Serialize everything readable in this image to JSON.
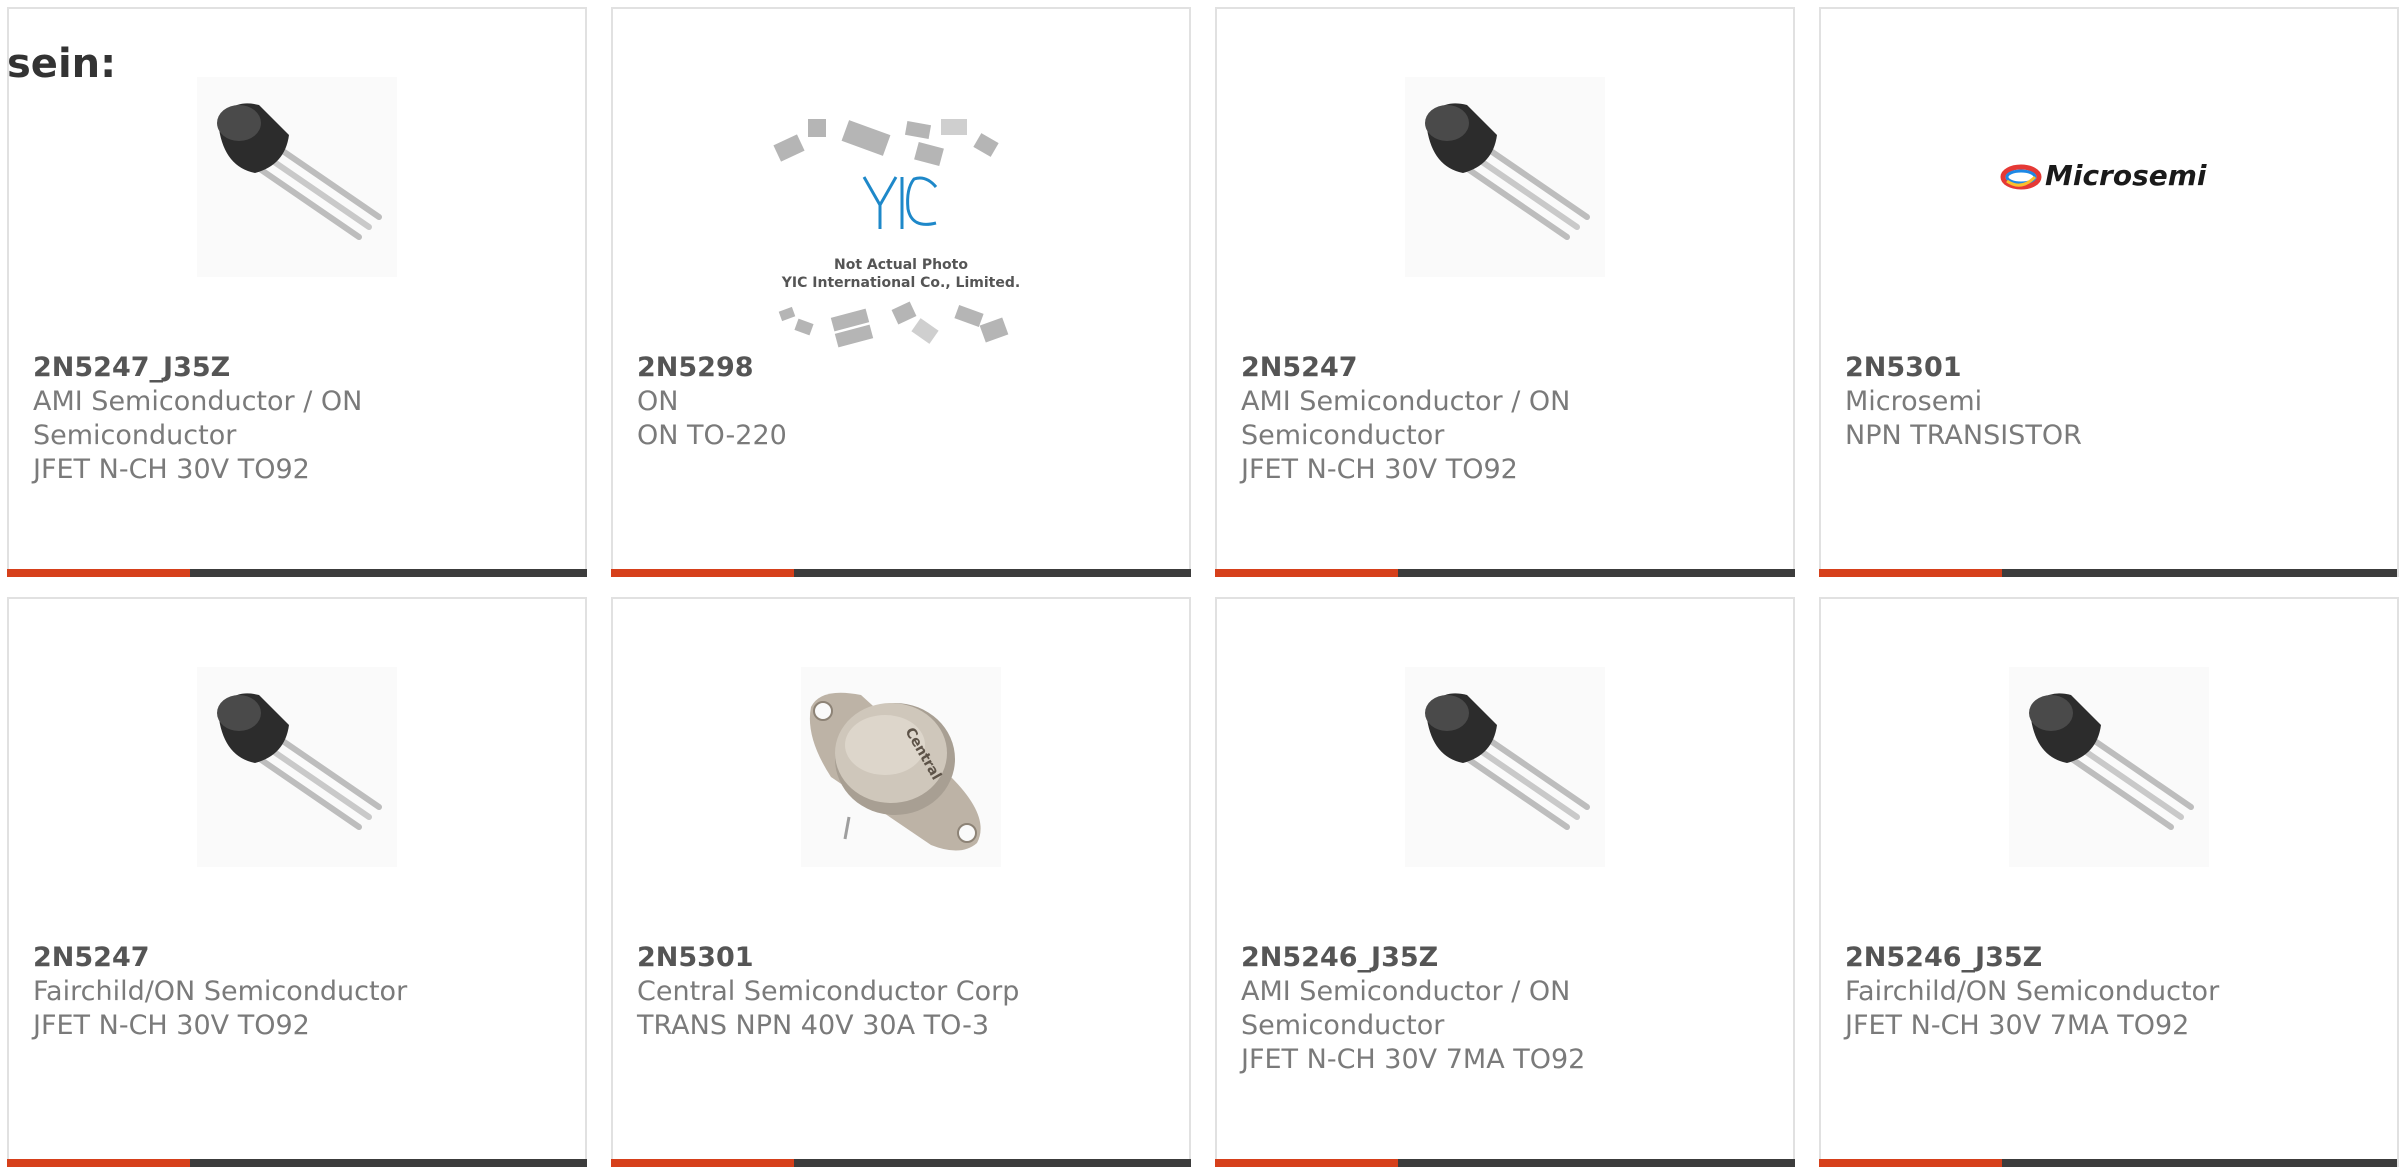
{
  "heading": "sein:",
  "colors": {
    "accent": "#d6401b",
    "bar": "#3c3c3c",
    "border": "#e1e1e1",
    "text": "#7a7a7a",
    "title": "#555555"
  },
  "cards": [
    {
      "pn": "2N5247_J35Z",
      "lines": [
        "AMI Semiconductor / ON",
        "Semiconductor",
        "JFET N-CH 30V TO92"
      ],
      "image": "to92-transistor"
    },
    {
      "pn": "2N5298",
      "lines": [
        "ON",
        "ON TO-220"
      ],
      "image": "not-actual-photo",
      "placeholder": {
        "logo": "YIC",
        "line1": "Not Actual Photo",
        "line2": "YIC International Co., Limited."
      }
    },
    {
      "pn": "2N5247",
      "lines": [
        "AMI Semiconductor / ON",
        "Semiconductor",
        "JFET N-CH 30V TO92"
      ],
      "image": "to92-transistor"
    },
    {
      "pn": "2N5301",
      "lines": [
        "Microsemi",
        "NPN TRANSISTOR"
      ],
      "image": "microsemi-logo",
      "logo_text": "Microsemi"
    },
    {
      "pn": "2N5247",
      "lines": [
        "Fairchild/ON Semiconductor",
        "JFET N-CH 30V TO92"
      ],
      "image": "to92-transistor"
    },
    {
      "pn": "2N5301",
      "lines": [
        "Central Semiconductor Corp",
        "TRANS NPN 40V 30A TO-3"
      ],
      "image": "to3-transistor",
      "logo_text": "Central"
    },
    {
      "pn": "2N5246_J35Z",
      "lines": [
        "AMI Semiconductor / ON",
        "Semiconductor",
        "JFET N-CH 30V 7MA TO92"
      ],
      "image": "to92-transistor"
    },
    {
      "pn": "2N5246_J35Z",
      "lines": [
        "Fairchild/ON Semiconductor",
        "JFET N-CH 30V 7MA TO92"
      ],
      "image": "to92-transistor"
    }
  ]
}
